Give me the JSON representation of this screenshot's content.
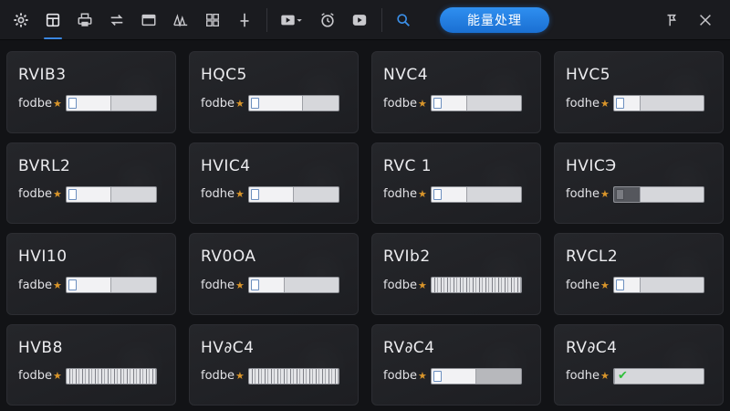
{
  "toolbar": {
    "primary_button_label": "能量处理",
    "accent_color": "#2a86ec"
  },
  "tiles": [
    {
      "title": "RVIB3",
      "label": "fodbe",
      "level": 0.5,
      "style": "normal"
    },
    {
      "title": "HQC5",
      "label": "fodbe",
      "level": 0.6,
      "style": "normal"
    },
    {
      "title": "NVC4",
      "label": "fodbe",
      "level": 0.4,
      "style": "normal"
    },
    {
      "title": "HVC5",
      "label": "fodhe",
      "level": 0.3,
      "style": "normal"
    },
    {
      "title": "BVRL2",
      "label": "fodbe",
      "level": 0.5,
      "style": "normal"
    },
    {
      "title": "HVIC4",
      "label": "fodhe",
      "level": 0.5,
      "style": "normal"
    },
    {
      "title": "RVC 1",
      "label": "fodhe",
      "level": 0.4,
      "style": "normal"
    },
    {
      "title": "HVICЭ",
      "label": "fodhe",
      "level": 0.3,
      "style": "dark"
    },
    {
      "title": "HVI10",
      "label": "fadbe",
      "level": 0.5,
      "style": "normal"
    },
    {
      "title": "RV0OA",
      "label": "fodhe",
      "level": 0.4,
      "style": "normal"
    },
    {
      "title": "RVIb2",
      "label": "fodbe",
      "level": 0.6,
      "style": "striped-light"
    },
    {
      "title": "RVCL2",
      "label": "fodhe",
      "level": 0.3,
      "style": "normal"
    },
    {
      "title": "HVB8",
      "label": "fodbe",
      "level": 1.0,
      "style": "striped"
    },
    {
      "title": "HV∂C4",
      "label": "fodbe",
      "level": 1.0,
      "style": "striped"
    },
    {
      "title": "RV∂C4",
      "label": "fodbe",
      "level": 0.5,
      "style": "dim"
    },
    {
      "title": "RV∂C4",
      "label": "fodhe",
      "level": 0.0,
      "style": "check"
    }
  ]
}
